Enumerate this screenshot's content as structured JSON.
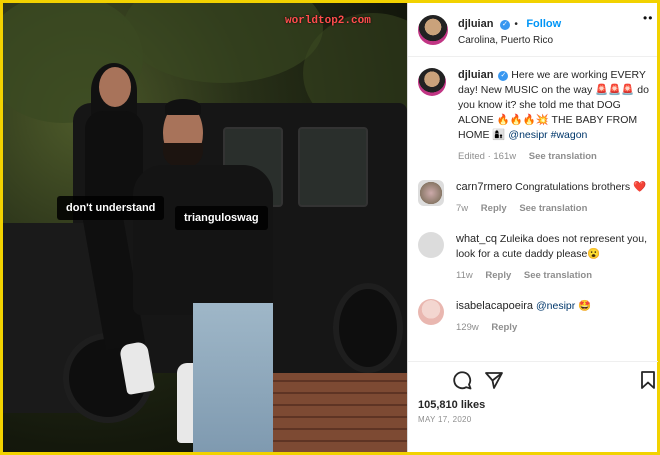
{
  "watermark": "worldtop2.com",
  "photo_tags": [
    {
      "label": "don't understand"
    },
    {
      "label": "trianguloswag"
    }
  ],
  "header": {
    "username": "djluian",
    "verified_icon": "verified-badge-icon",
    "separator": "•",
    "follow_label": "Follow",
    "location": "Carolina, Puerto Rico",
    "more_icon": "more-options-icon"
  },
  "caption": {
    "username": "djluian",
    "text_part1": "Here we are working EVERY day! New MUSIC on the way 🚨🚨🚨 do you know it? she told me that DOG ALONE 🔥🔥🔥💥 THE BABY FROM HOME 👩‍👦 ",
    "mention": "@nesipr",
    "hashtag": "#wagon",
    "edited": "Edited · 161w",
    "see_translation": "See translation"
  },
  "comments": [
    {
      "username": "carn7rmero",
      "text": "Congratulations brothers ❤️",
      "time": "7w",
      "reply": "Reply",
      "see_translation": "See translation"
    },
    {
      "username": "what_cq",
      "text": "Zuleika does not represent you, look for a cute daddy please😮",
      "time": "11w",
      "reply": "Reply",
      "see_translation": "See translation"
    },
    {
      "username": "isabelacapoeira",
      "text": "🤩",
      "mention": "@nesipr",
      "time": "129w",
      "reply": "Reply"
    }
  ],
  "actions": {
    "comment_icon": "comment-icon",
    "share_icon": "share-icon",
    "bookmark_icon": "bookmark-icon"
  },
  "likes": "105,810 likes",
  "date": "MAY 17, 2020",
  "colors": {
    "follow": "#0095f6",
    "verified": "#3897f0",
    "frame": "#f2d200",
    "watermark": "#ff4d4d"
  }
}
